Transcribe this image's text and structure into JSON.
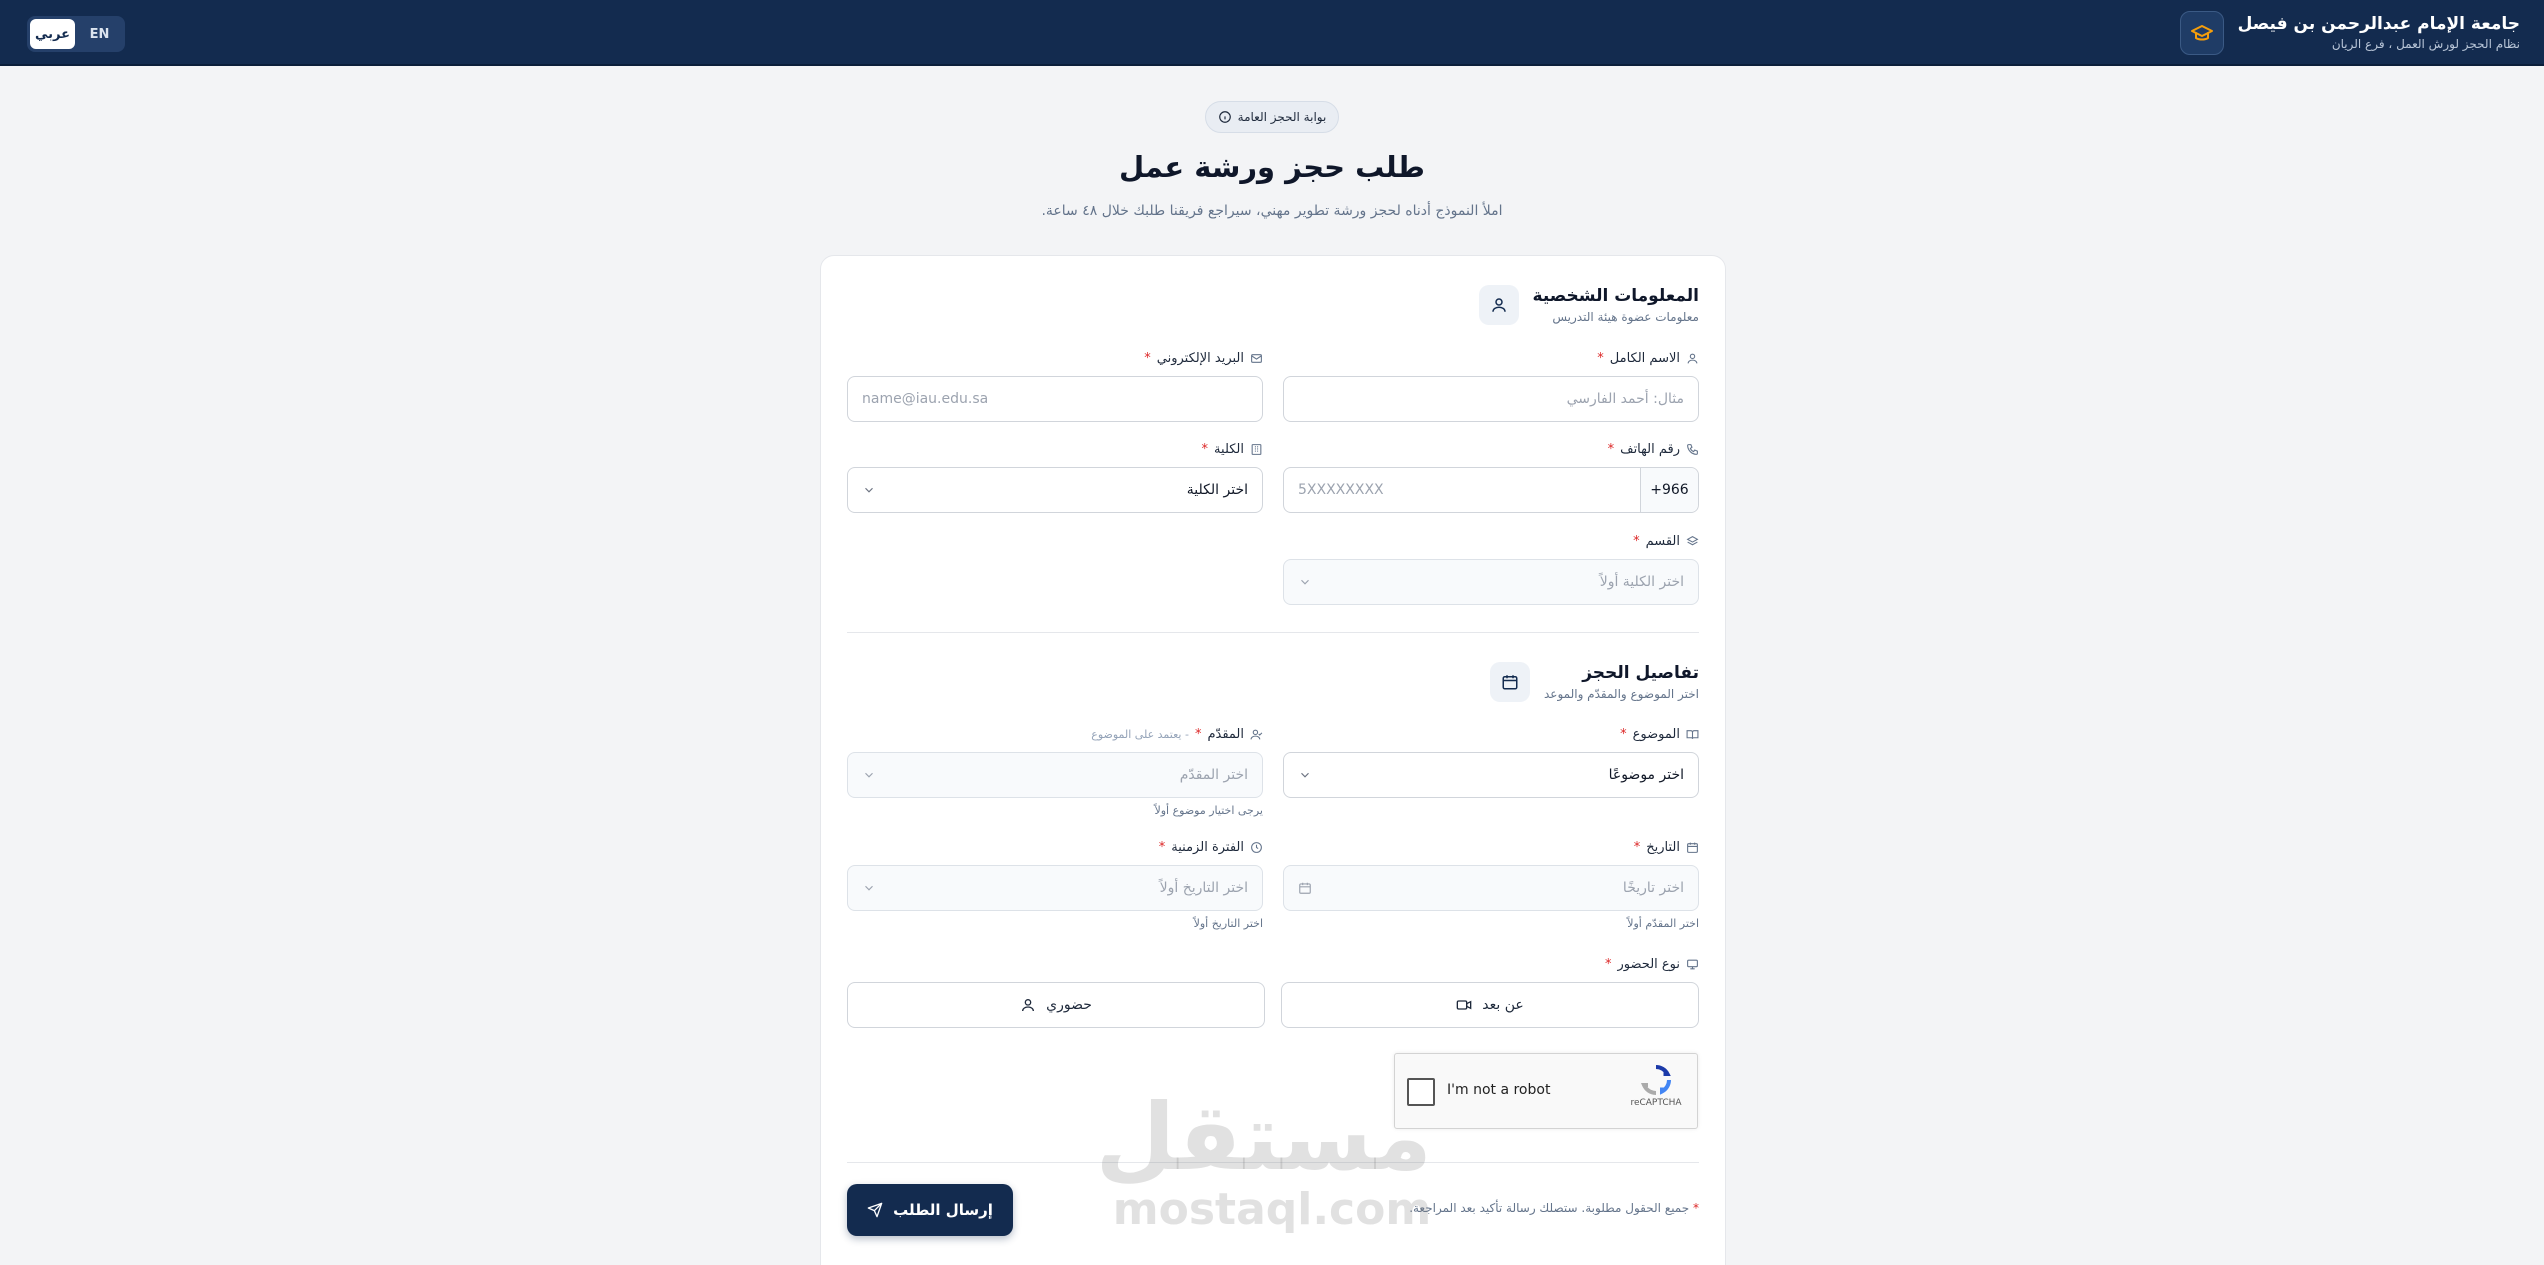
{
  "header": {
    "title": "جامعة الإمام عبدالرحمن بن فيصل",
    "subtitle": "نظام الحجز لورش العمل ، فرع الريان",
    "lang_ar": "عربي",
    "lang_en": "EN"
  },
  "hero": {
    "badge": "بوابة الحجز العامة",
    "title": "طلب حجز ورشة عمل",
    "subtitle": "املأ النموذج أدناه لحجز ورشة تطوير مهني، سيراجع فريقنا طلبك خلال ٤٨ ساعة."
  },
  "personal": {
    "title": "المعلومات الشخصية",
    "subtitle": "معلومات عضوة هيئة التدريس",
    "full_name_label": "الاسم الكامل",
    "full_name_placeholder": "مثال: أحمد الفارسي",
    "email_label": "البريد الإلكتروني",
    "email_placeholder": "name@iau.edu.sa",
    "phone_label": "رقم الهاتف",
    "phone_code": "+966",
    "phone_placeholder": "5XXXXXXXX",
    "college_label": "الكلية",
    "college_value": "اختر الكلية",
    "department_label": "القسم",
    "department_placeholder": "اختر الكلية أولاً"
  },
  "booking": {
    "title": "تفاصيل الحجز",
    "subtitle": "اختر الموضوع والمقدّم والموعد",
    "topic_label": "الموضوع",
    "topic_value": "اختر موضوعًا",
    "presenter_label": "المقدّم",
    "presenter_note": "- يعتمد على الموضوع",
    "presenter_placeholder": "اختر المقدّم",
    "presenter_help": "يرجى اختيار موضوع أولاً",
    "date_label": "التاريخ",
    "date_placeholder": "اختر تاريخًا",
    "date_help": "اختر المقدّم أولاً",
    "slot_label": "الفترة الزمنية",
    "slot_placeholder": "اختر التاريخ أولاً",
    "slot_help": "اختر التاريخ أولاً",
    "attendance_label": "نوع الحضور",
    "remote": "عن بعد",
    "in_person": "حضوري",
    "required_mark": "*"
  },
  "captcha": {
    "text": "I'm not a robot",
    "brand": "reCAPTCHA"
  },
  "footer": {
    "note": "جميع الحقول مطلوبة. ستصلك رسالة تأكيد بعد المراجعة.",
    "submit": "إرسال الطلب"
  },
  "watermark": {
    "ar": "مستقل",
    "en": "mostaql.com"
  },
  "colors": {
    "primary": "#132b4f",
    "required": "#dc2626",
    "background": "#f3f4f6"
  }
}
